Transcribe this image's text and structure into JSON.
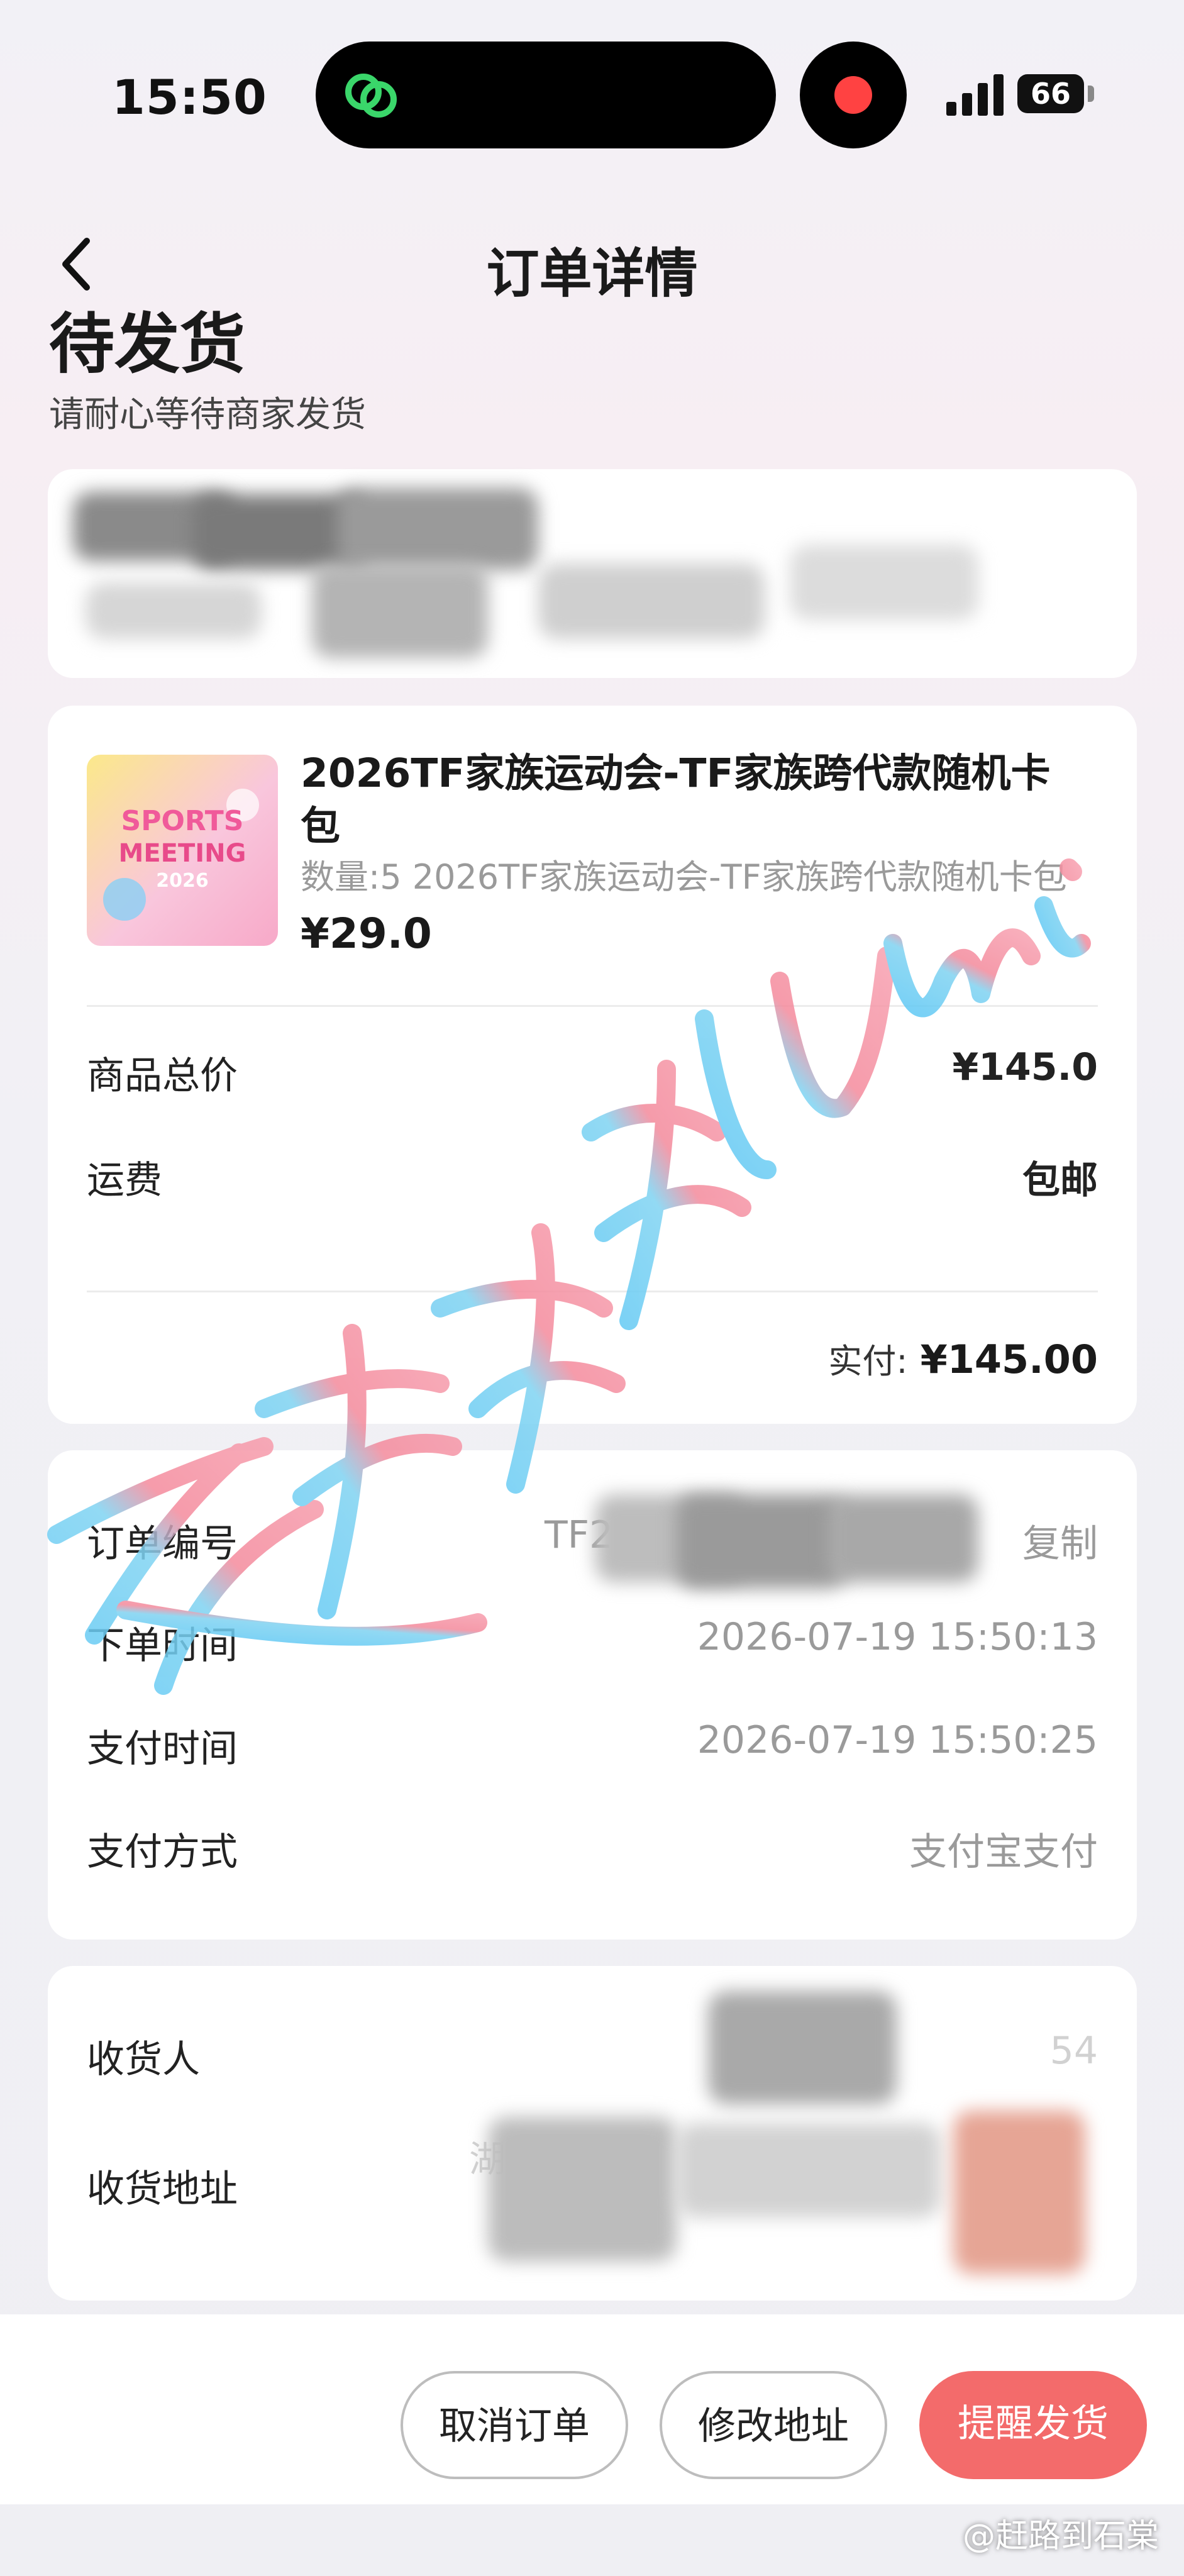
{
  "status_bar": {
    "time": "15:50",
    "battery": "66"
  },
  "nav": {
    "title": "订单详情",
    "back_icon": "chevron-left-icon"
  },
  "order_status": {
    "title": "待发货",
    "subtitle": "请耐心等待商家发货"
  },
  "product": {
    "name": "2026TF家族运动会-TF家族跨代款随机卡包",
    "spec": "数量:5 2026TF家族运动会-TF家族跨代款随机卡包",
    "price": "¥29.0",
    "thumbnail_text": "SPORTS MEETING 2026"
  },
  "pricing": {
    "goods_total_label": "商品总价",
    "goods_total_value": "¥145.0",
    "shipping_label": "运费",
    "shipping_value": "包邮",
    "paid_label": "实付:",
    "paid_value": "¥145.00"
  },
  "order_info": {
    "order_no_label": "订单编号",
    "order_no_value": "TF20",
    "copy_label": "复制",
    "order_time_label": "下单时间",
    "order_time_value": "2026-07-19 15:50:13",
    "pay_time_label": "支付时间",
    "pay_time_value": "2026-07-19 15:50:25",
    "pay_method_label": "支付方式",
    "pay_method_value": "支付宝支付"
  },
  "address": {
    "receiver_label": "收货人",
    "receiver_value": "54",
    "address_label": "收货地址",
    "address_value": "湖南省"
  },
  "actions": {
    "cancel": "取消订单",
    "edit_address": "修改地址",
    "remind": "提醒发货"
  },
  "watermark": {
    "overlay_text": "赶路到石棠 lumi",
    "credit": "@赶路到石棠"
  },
  "colors": {
    "primary": "#f36b6b",
    "card": "#ffffff",
    "watermark_blue": "#5ec8f5",
    "watermark_pink": "#f48a9c"
  }
}
